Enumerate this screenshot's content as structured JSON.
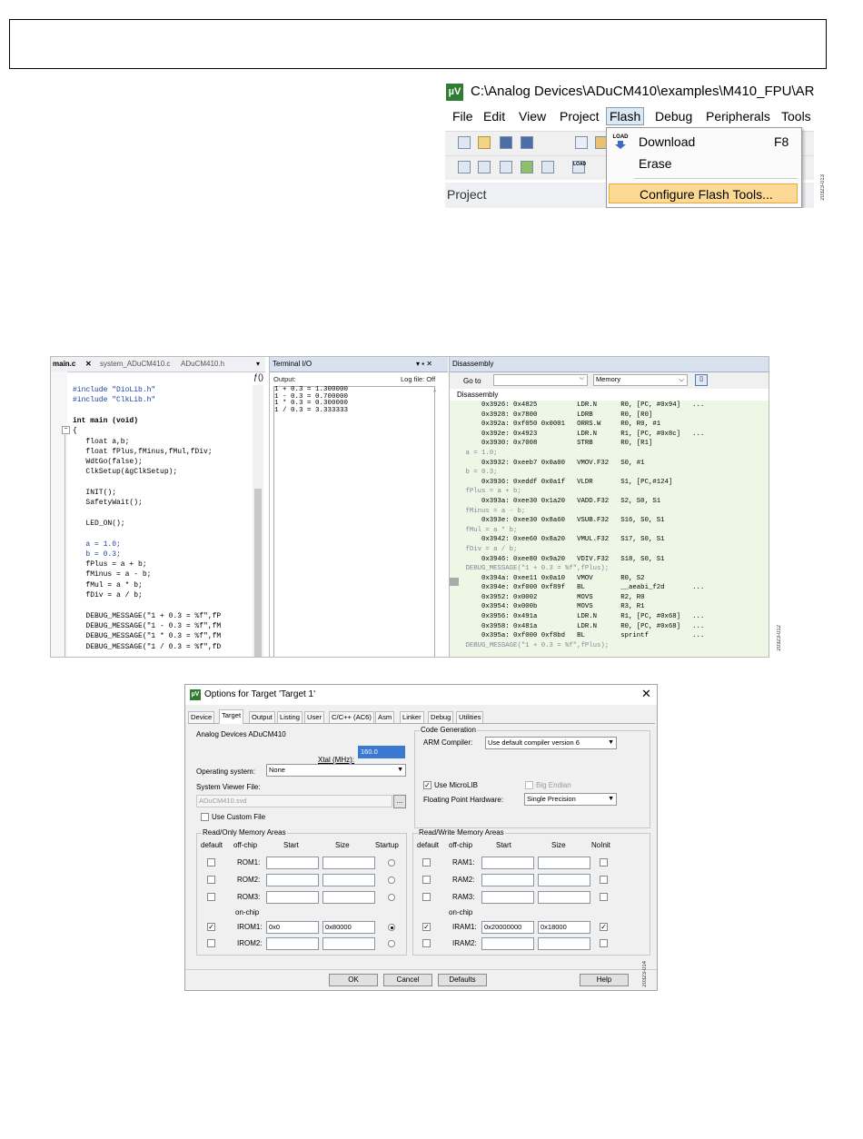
{
  "figures": [
    {
      "id": "20323-013"
    },
    {
      "id": "20323-012"
    },
    {
      "id": "20323-014"
    }
  ],
  "flash_menu": {
    "app_icon": "µV",
    "window_title": "C:\\Analog Devices\\ADuCM410\\examples\\M410_FPU\\AR",
    "menu": [
      "File",
      "Edit",
      "View",
      "Project",
      "Flash",
      "Debug",
      "Peripherals",
      "Tools"
    ],
    "active_menu": "Flash",
    "items": [
      {
        "label": "Download",
        "shortcut": "F8",
        "icon": "load-icon"
      },
      {
        "label": "Erase",
        "shortcut": "",
        "icon": ""
      },
      {
        "label": "Configure Flash Tools...",
        "shortcut": "",
        "icon": "",
        "highlighted": true
      }
    ],
    "load_icon_text": "LOAD",
    "project_label": "Project"
  },
  "ide": {
    "tabs": [
      "main.c",
      "system_ADuCM410.c",
      "ADuCM410.h"
    ],
    "tab_close": "✕",
    "tab_overflow": "ƒ()",
    "code": [
      "#include \"DioLib.h\"",
      "#include \"ClkLib.h\"",
      "",
      "int main (void)",
      "{",
      "   float a,b;",
      "   float fPlus,fMinus,fMul,fDiv;",
      "   WdtGo(false);",
      "   ClkSetup(&gClkSetup);",
      "",
      "   INIT();",
      "   SafetyWait();",
      "",
      "   LED_ON();",
      "",
      "   a = 1.0;",
      "   b = 0.3;",
      "   fPlus = a + b;",
      "   fMinus = a - b;",
      "   fMul = a * b;",
      "   fDiv = a / b;",
      "",
      "   DEBUG_MESSAGE(\"1 + 0.3 = %f\",fP",
      "   DEBUG_MESSAGE(\"1 - 0.3 = %f\",fM",
      "   DEBUG_MESSAGE(\"1 * 0.3 = %f\",fM",
      "   DEBUG_MESSAGE(\"1 / 0.3 = %f\",fD"
    ],
    "terminal": {
      "title": "Terminal I/O",
      "pin": "▾ ▪ ✕",
      "output_label": "Output:",
      "log_label": "Log file: Off",
      "lines": [
        "1 + 0.3 = 1.300000",
        "1 - 0.3 = 0.700000",
        "1 * 0.3 = 0.300000",
        "1 / 0.3 = 3.333333"
      ]
    },
    "disassembly": {
      "title": "Disassembly",
      "goto_label": "Go to",
      "memory_label": "Memory",
      "section_label": "Disassembly",
      "rows": [
        {
          "t": "        0x3926: 0x4825          LDR.N      R0, [PC, #0x94]   ...",
          "src": false
        },
        {
          "t": "        0x3928: 0x7800          LDRB       R0, [R0]",
          "src": false
        },
        {
          "t": "        0x392a: 0xf050 0x0001   ORRS.W     R0, R0, #1",
          "src": false
        },
        {
          "t": "        0x392e: 0x4923          LDR.N      R1, [PC, #0x8c]   ...",
          "src": false
        },
        {
          "t": "        0x3930: 0x7008          STRB       R0, [R1]",
          "src": false
        },
        {
          "t": "    a = 1.0;",
          "src": true
        },
        {
          "t": "        0x3932: 0xeeb7 0x0a00   VMOV.F32   S0, #1",
          "src": false
        },
        {
          "t": "    b = 0.3;",
          "src": true
        },
        {
          "t": "        0x3936: 0xeddf 0x0a1f   VLDR       S1, [PC,#124]",
          "src": false
        },
        {
          "t": "    fPlus = a + b;",
          "src": true
        },
        {
          "t": "        0x393a: 0xee30 0x1a20   VADD.F32   S2, S0, S1",
          "src": false
        },
        {
          "t": "    fMinus = a - b;",
          "src": true
        },
        {
          "t": "        0x393e: 0xee30 0x8a60   VSUB.F32   S16, S0, S1",
          "src": false
        },
        {
          "t": "    fMul = a * b;",
          "src": true
        },
        {
          "t": "        0x3942: 0xee60 0x8a20   VMUL.F32   S17, S0, S1",
          "src": false
        },
        {
          "t": "    fDiv = a / b;",
          "src": true
        },
        {
          "t": "        0x3946: 0xee80 0x9a20   VDIV.F32   S18, S0, S1",
          "src": false
        },
        {
          "t": "    DEBUG_MESSAGE(\"1 + 0.3 = %f\",fPlus);",
          "src": true
        },
        {
          "t": "        0x394a: 0xee11 0x0a10   VMOV       R0, S2",
          "src": false
        },
        {
          "t": "        0x394e: 0xf000 0xf89f   BL         __aeabi_f2d       ...",
          "src": false
        },
        {
          "t": "        0x3952: 0x0002          MOVS       R2, R0",
          "src": false
        },
        {
          "t": "        0x3954: 0x000b          MOVS       R3, R1",
          "src": false
        },
        {
          "t": "        0x3956: 0x491a          LDR.N      R1, [PC, #0x68]   ...",
          "src": false
        },
        {
          "t": "        0x3958: 0x481a          LDR.N      R0, [PC, #0x68]   ...",
          "src": false
        },
        {
          "t": "        0x395a: 0xf000 0xf8bd   BL         sprintf           ...",
          "src": false
        },
        {
          "t": "    DEBUG_MESSAGE(\"1 + 0.3 = %f\",fPlus);",
          "src": true
        }
      ]
    }
  },
  "dialog": {
    "app_icon": "µV",
    "title": "Options for Target 'Target 1'",
    "close": "✕",
    "tabs": [
      "Device",
      "Target",
      "Output",
      "Listing",
      "User",
      "C/C++ (AC6)",
      "Asm",
      "Linker",
      "Debug",
      "Utilities"
    ],
    "selected_tab": "Target",
    "device_name": "Analog Devices ADuCM410",
    "xtal_label": "Xtal (MHz):",
    "xtal_value": "160.0",
    "os_label": "Operating system:",
    "os_value": "None",
    "svd_label": "System Viewer File:",
    "svd_value": "ADuCM410.svd",
    "svd_browse": "...",
    "custom_file_label": "Use Custom File",
    "code_gen_title": "Code Generation",
    "arm_compiler_label": "ARM Compiler:",
    "arm_compiler_value": "Use default compiler version 6",
    "microlib_label": "Use MicroLIB",
    "big_endian_label": "Big Endian",
    "fph_label": "Floating Point Hardware:",
    "fph_value": "Single Precision",
    "ro_title": "Read/Only Memory Areas",
    "rw_title": "Read/Write Memory Areas",
    "col_default": "default",
    "col_offchip": "off-chip",
    "col_start": "Start",
    "col_size": "Size",
    "col_startup": "Startup",
    "col_noinit": "NoInit",
    "on_chip_label": "on-chip",
    "ro_rows": [
      {
        "name": "ROM1:",
        "start": "",
        "size": "",
        "default": false,
        "startup": false
      },
      {
        "name": "ROM2:",
        "start": "",
        "size": "",
        "default": false,
        "startup": false
      },
      {
        "name": "ROM3:",
        "start": "",
        "size": "",
        "default": false,
        "startup": false
      },
      {
        "name": "IROM1:",
        "start": "0x0",
        "size": "0x80000",
        "default": true,
        "startup": true
      },
      {
        "name": "IROM2:",
        "start": "",
        "size": "",
        "default": false,
        "startup": false
      }
    ],
    "rw_rows": [
      {
        "name": "RAM1:",
        "start": "",
        "size": "",
        "default": false,
        "noinit": false
      },
      {
        "name": "RAM2:",
        "start": "",
        "size": "",
        "default": false,
        "noinit": false
      },
      {
        "name": "RAM3:",
        "start": "",
        "size": "",
        "default": false,
        "noinit": false
      },
      {
        "name": "IRAM1:",
        "start": "0x20000000",
        "size": "0x18000",
        "default": true,
        "noinit": true
      },
      {
        "name": "IRAM2:",
        "start": "",
        "size": "",
        "default": false,
        "noinit": false
      }
    ],
    "buttons": {
      "ok": "OK",
      "cancel": "Cancel",
      "defaults": "Defaults",
      "help": "Help"
    }
  }
}
